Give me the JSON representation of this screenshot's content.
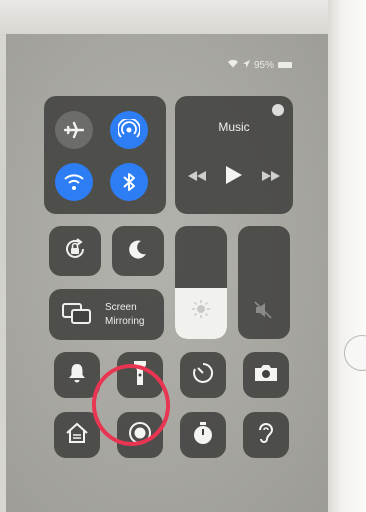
{
  "status_bar": {
    "wifi_icon": "wifi-icon",
    "battery_text": "95%",
    "battery_icon": "battery-icon"
  },
  "connectivity": {
    "airplane": {
      "icon": "airplane-icon",
      "active": false
    },
    "airdrop": {
      "icon": "airdrop-icon",
      "active": true
    },
    "wifi": {
      "icon": "wifi-icon",
      "active": true
    },
    "bluetooth": {
      "icon": "bluetooth-icon",
      "active": true
    }
  },
  "music": {
    "title": "Music",
    "controls": [
      "rewind-icon",
      "play-icon",
      "fast-forward-icon"
    ]
  },
  "toggles": {
    "rotation_lock": "rotation-lock-icon",
    "do_not_disturb": "moon-icon"
  },
  "brightness": {
    "icon": "sun-icon",
    "level": 0.45
  },
  "volume": {
    "icon": "speaker-muted-icon",
    "level": 0.0
  },
  "screen_mirroring": {
    "line1": "Screen",
    "line2": "Mirroring"
  },
  "shortcuts": [
    "bell-icon",
    "flashlight-icon",
    "timer-icon",
    "camera-icon",
    "home-icon",
    "screen-record-icon",
    "stopwatch-icon",
    "hearing-icon"
  ],
  "colors": {
    "accent_blue": "#2d7df5",
    "annotation_red": "#e83552",
    "tile_bg": "#41413f"
  }
}
